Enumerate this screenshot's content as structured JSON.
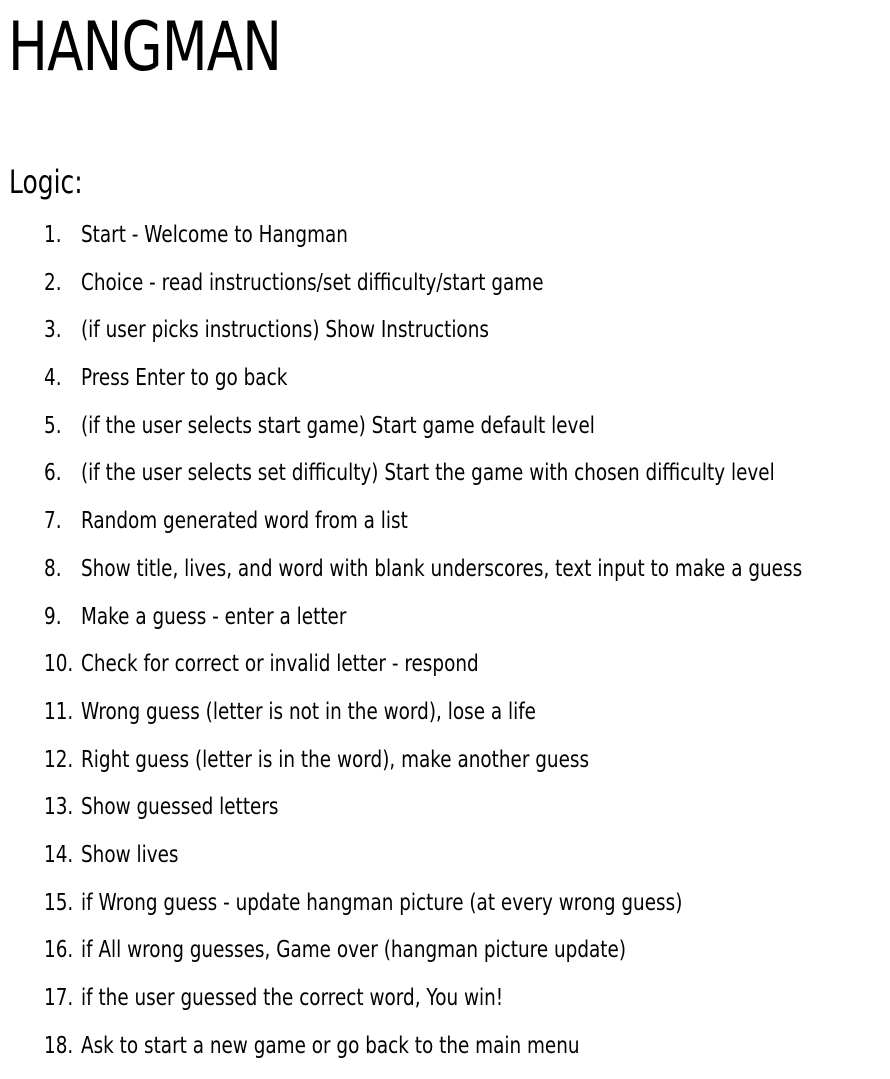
{
  "document": {
    "title": "HANGMAN",
    "section_heading": "Logic:",
    "steps": [
      {
        "number": "1.",
        "text": "Start - Welcome to Hangman"
      },
      {
        "number": "2.",
        "text": "Choice - read instructions/set difficulty/start game"
      },
      {
        "number": "3.",
        "text": "(if user picks instructions) Show Instructions"
      },
      {
        "number": "4.",
        "text": "Press Enter to go back"
      },
      {
        "number": "5.",
        "text": "(if the user selects start game) Start game default level"
      },
      {
        "number": "6.",
        "text": "(if the user selects set difficulty) Start the game with chosen difficulty level"
      },
      {
        "number": "7.",
        "text": "Random generated word from a list"
      },
      {
        "number": "8.",
        "text": "Show title, lives, and word with blank underscores, text input to make a guess"
      },
      {
        "number": "9.",
        "text": "Make a guess - enter a letter"
      },
      {
        "number": "10.",
        "text": "Check for correct or invalid letter - respond"
      },
      {
        "number": "11.",
        "text": "Wrong guess (letter is not in the word), lose a life"
      },
      {
        "number": "12.",
        "text": "Right guess (letter is in the word), make another guess"
      },
      {
        "number": "13.",
        "text": "Show guessed letters"
      },
      {
        "number": "14.",
        "text": "Show lives"
      },
      {
        "number": "15.",
        "text": "if Wrong guess - update hangman picture (at every wrong guess)"
      },
      {
        "number": "16.",
        "text": "if All wrong guesses, Game over (hangman picture update)"
      },
      {
        "number": "17.",
        "text": "if the user guessed the correct word, You win!"
      },
      {
        "number": "18.",
        "text": "Ask to start a new game or go back to the main menu"
      }
    ]
  }
}
